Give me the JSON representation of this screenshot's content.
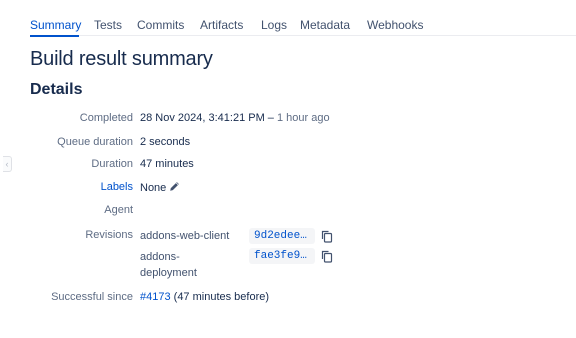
{
  "tabs": [
    {
      "label": "Summary",
      "active": true
    },
    {
      "label": "Tests"
    },
    {
      "label": "Commits"
    },
    {
      "label": "Artifacts"
    },
    {
      "label": "Logs"
    },
    {
      "label": "Metadata"
    },
    {
      "label": "Webhooks"
    }
  ],
  "page_title": "Build result summary",
  "section_title": "Details",
  "details": {
    "completed": {
      "label": "Completed",
      "value": "28 Nov 2024, 3:41:21 PM",
      "relative": "1 hour ago"
    },
    "queue_duration": {
      "label": "Queue duration",
      "value": "2 seconds"
    },
    "duration": {
      "label": "Duration",
      "value": "47 minutes"
    },
    "labels": {
      "label": "Labels",
      "value": "None"
    },
    "agent": {
      "label": "Agent",
      "value": ""
    },
    "revisions": {
      "label": "Revisions",
      "items": [
        {
          "repo": "addons-web-client",
          "hash": "9d2edee…"
        },
        {
          "repo": "addons-deployment",
          "hash": "fae3fe9…"
        }
      ]
    },
    "successful_since": {
      "label": "Successful since",
      "build": "#4173",
      "note": "(47 minutes before)"
    }
  },
  "colors": {
    "accent": "#0052cc",
    "text": "#172b4d",
    "muted": "#5e6c84"
  },
  "icons": {
    "edit": "pencil-icon",
    "copy": "copy-icon",
    "collapse": "chevron-left-icon"
  }
}
